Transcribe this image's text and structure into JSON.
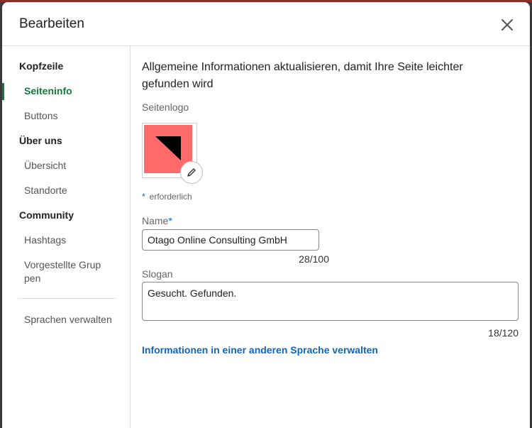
{
  "dialog": {
    "title": "Bearbeiten",
    "close_icon": "close-icon"
  },
  "sidebar": {
    "sections": [
      {
        "label": "Kopfzeile",
        "items": [
          "Seiteninfo",
          "Buttons"
        ]
      },
      {
        "label": "Über uns",
        "items": [
          "Übersicht",
          "Standorte"
        ]
      },
      {
        "label": "Community",
        "items": [
          "Hashtags",
          "Vorgestellte Gruppen"
        ]
      }
    ],
    "active_item": "Seiteninfo",
    "footer_item": "Sprachen verwalten"
  },
  "main": {
    "intro": "Allgemeine Informationen aktualisieren, damit Ihre Seite leichter gefunden wird",
    "logo_label": "Seitenlogo",
    "logo_edit_icon": "pencil-icon",
    "required_star": "*",
    "required_text": "erforderlich",
    "name_label": "Name",
    "name_value": "Otago Online Consulting GmbH",
    "name_count": "28/100",
    "slogan_label": "Slogan",
    "slogan_value": "Gesucht. Gefunden.",
    "slogan_count": "18/120",
    "manage_link": "Informationen in einer anderen Sprache verwalten"
  },
  "colors": {
    "accent_green": "#147a3c",
    "link_blue": "#0a66c2",
    "logo_bg": "#ff6b6b"
  }
}
